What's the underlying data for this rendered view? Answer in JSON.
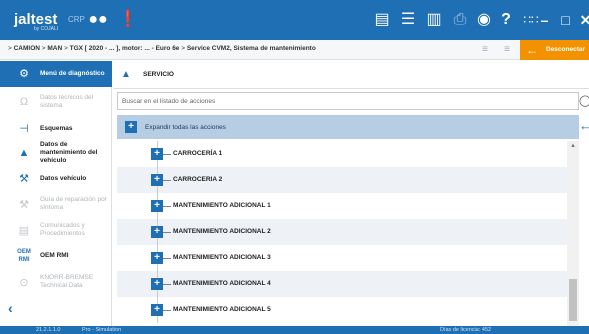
{
  "topbar": {
    "brand": "jaltest",
    "brand_sub": "by COJALI",
    "product": "CRP",
    "colors": {
      "bar": "#1e6fb4",
      "accent": "#f39200"
    }
  },
  "breadcrumb": {
    "items": [
      "CAMIÓN",
      "MAN",
      "TGX [ 2020 - ... ], motor: ... - Euro 6e",
      "Service CVM2, Sistema de mantenimiento"
    ],
    "separator": ">"
  },
  "disconnect_label": "Desconectar",
  "sidebar": {
    "items": [
      {
        "label": "Menú de diagnóstico",
        "icon": "diagnostic-icon",
        "state": "active"
      },
      {
        "label": "Datos técnicos del sistema",
        "icon": "omega-icon",
        "state": "disabled"
      },
      {
        "label": "Esquemas",
        "icon": "schematic-icon",
        "state": "enabled"
      },
      {
        "label": "Datos de mantenimiento del vehículo",
        "icon": "oil-can-icon",
        "state": "enabled"
      },
      {
        "label": "Datos vehículo",
        "icon": "wrench-icon",
        "state": "enabled"
      },
      {
        "label": "Guía de reparación por síntoma",
        "icon": "tools-icon",
        "state": "disabled"
      },
      {
        "label": "Comunicados y Procedimientos",
        "icon": "document-icon",
        "state": "disabled"
      },
      {
        "label": "OEM RMI",
        "icon": "oem-rmi-icon",
        "state": "enabled"
      },
      {
        "label": "KNORR-BREMSE Technical Data",
        "icon": "knorr-icon",
        "state": "disabled"
      }
    ]
  },
  "main": {
    "title": "SERVICIO",
    "search_placeholder": "Buscar en el listado de acciones",
    "expand_all_label": "Expandir todas las acciones",
    "rows": [
      "CARROCERÍA 1",
      "CARROCERIA 2",
      "MANTENIMIENTO ADICIONAL 1",
      "MANTENIMIENTO ADICIONAL 2",
      "MANTENIMIENTO ADICIONAL 3",
      "MANTENIMIENTO ADICIONAL 4",
      "MANTENIMIENTO ADICIONAL 5"
    ]
  },
  "statusbar": {
    "version": "21.2.1.1.0",
    "mode": "Pro - Simulation",
    "right": "Días de licencia: 452"
  }
}
